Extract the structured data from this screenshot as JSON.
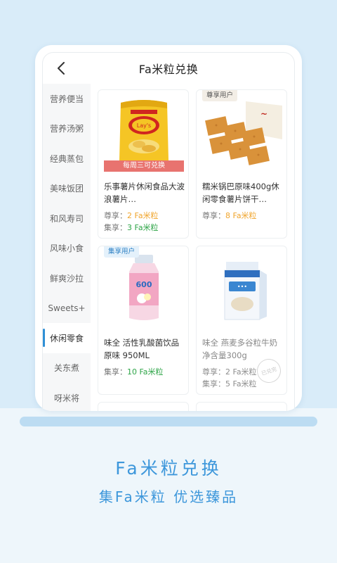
{
  "header": {
    "title": "Fa米粒兑换"
  },
  "sidebar": {
    "items": [
      {
        "label": "营养便当"
      },
      {
        "label": "营养汤粥"
      },
      {
        "label": "经典蒸包"
      },
      {
        "label": "美味饭团"
      },
      {
        "label": "和风寿司"
      },
      {
        "label": "风味小食"
      },
      {
        "label": "鲜爽沙拉"
      },
      {
        "label": "Sweets+"
      },
      {
        "label": "休闲零食"
      },
      {
        "label": "关东煮"
      },
      {
        "label": "呀米将"
      }
    ],
    "active_index": 8
  },
  "products": [
    {
      "name": "乐事薯片休闲食品大波浪薯片…",
      "banner": "每周三可兑换",
      "lines": [
        {
          "label": "尊享：",
          "value": "2 Fa米粒",
          "color": "orange"
        },
        {
          "label": "集享：",
          "value": "3 Fa米粒",
          "color": "green"
        }
      ],
      "image_icon": "potato-chips-image"
    },
    {
      "name": "糯米锅巴原味400g休闲零食薯片饼干…",
      "tag": "尊享用户",
      "lines": [
        {
          "label": "尊享：",
          "value": "8 Fa米粒",
          "color": "orange"
        }
      ],
      "image_icon": "crispy-rice-crackers-image"
    },
    {
      "name": "味全 活性乳酸菌饮品原味 950ML",
      "tag": "集享用户",
      "lines": [
        {
          "label": "集享：",
          "value": "10 Fa米粒",
          "color": "green"
        }
      ],
      "image_icon": "yogurt-drink-bottle-image"
    },
    {
      "name": "味全 燕麦多谷粒牛奶净含量300g",
      "lines": [
        {
          "label": "尊享：",
          "value": "2 Fa米粒",
          "color": "gray"
        },
        {
          "label": "集享：",
          "value": "5 Fa米粒",
          "color": "gray"
        }
      ],
      "stamp": "已兑完",
      "image_icon": "oat-milk-carton-image"
    }
  ],
  "promo": {
    "headline": "Fa米粒兑换",
    "subline": "集Fa米粒 优选臻品"
  },
  "colors": {
    "accent_blue": "#3d97db",
    "orange": "#f0a52d",
    "green": "#2ea548",
    "red_banner": "#e8736f"
  }
}
